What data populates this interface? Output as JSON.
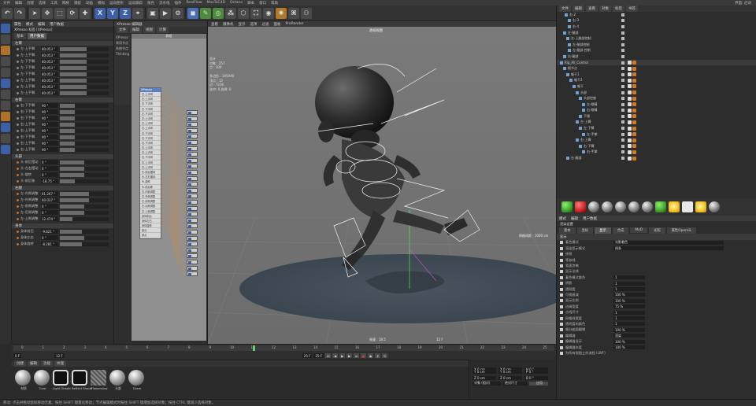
{
  "app": {
    "menu": [
      "文件",
      "编辑",
      "创建",
      "选择",
      "工具",
      "网格",
      "捕捉",
      "动画",
      "模拟",
      "运动图形",
      "运动跟踪",
      "角色",
      "流水线",
      "插件",
      "RealFlow",
      "MaxToC4D",
      "Octane",
      "脚本",
      "窗口",
      "帮助"
    ],
    "right_menu": "界面: 启动"
  },
  "toolbar": {
    "x": "X",
    "y": "Y",
    "z": "Z"
  },
  "attribute_panel": {
    "title": "属性",
    "title_tabs": [
      "模式",
      "编辑",
      "用户数据"
    ],
    "object_name": "XPresso 标签 [XPresso]",
    "tabs": [
      "基本",
      "用户数据"
    ],
    "sections": [
      {
        "name": "左臂",
        "rows": [
          {
            "label": "左-上手臂",
            "value": "80.053 °",
            "fill": 0.55
          },
          {
            "label": "左-上手臂",
            "value": "80.053 °",
            "fill": 0.55
          },
          {
            "label": "左-下手臂",
            "value": "80.053 °",
            "fill": 0.55
          },
          {
            "label": "左-下手臂",
            "value": "80.053 °",
            "fill": 0.55
          },
          {
            "label": "左-下手臂",
            "value": "80.053 °",
            "fill": 0.55
          },
          {
            "label": "左-上手臂",
            "value": "80.053 °",
            "fill": 0.55
          },
          {
            "label": "左-上手臂",
            "value": "80.053 °",
            "fill": 0.55
          },
          {
            "label": "左-上手臂",
            "value": "80.053 °",
            "fill": 0.55
          }
        ]
      },
      {
        "name": "右臂",
        "rows": [
          {
            "label": "右-下手臂",
            "value": "90 °",
            "fill": 0.3
          },
          {
            "label": "右-下手臂",
            "value": "90 °",
            "fill": 0.3
          },
          {
            "label": "右-下手臂",
            "value": "90 °",
            "fill": 0.3
          },
          {
            "label": "右-上手臂",
            "value": "90 °",
            "fill": 0.3
          },
          {
            "label": "右-上手臂",
            "value": "90 °",
            "fill": 0.3
          },
          {
            "label": "右-下手臂",
            "value": "90 °",
            "fill": 0.3
          },
          {
            "label": "右-上手臂",
            "value": "90 °",
            "fill": 0.3
          },
          {
            "label": "右-上手臂",
            "value": "90 °",
            "fill": 0.3
          }
        ]
      },
      {
        "name": "头部",
        "rows": [
          {
            "label": "头-前后摆动",
            "value": "0 °",
            "fill": 0.5
          },
          {
            "label": "头-左右摆动",
            "value": "0 °",
            "fill": 0.5
          },
          {
            "label": "头-旋转",
            "value": "0 °",
            "fill": 0.5
          },
          {
            "label": "头-前后移",
            "value": "-18.75 °",
            "fill": 0.3
          }
        ]
      },
      {
        "name": "左腿",
        "rows": [
          {
            "label": "左-内侧调整",
            "value": "61.267 °",
            "fill": 0.6
          },
          {
            "label": "左-外侧调整",
            "value": "60.037 °",
            "fill": 0.6
          },
          {
            "label": "左-前侧调整",
            "value": "0 °",
            "fill": 0.5
          },
          {
            "label": "左-后侧调整",
            "value": "0 °",
            "fill": 0.5
          },
          {
            "label": "左-上侧调整",
            "value": "12.474 °",
            "fill": 0.25
          }
        ]
      },
      {
        "name": "身体",
        "rows": [
          {
            "label": "身体前后",
            "value": "-9.821 °",
            "fill": 0.45
          },
          {
            "label": "身体左右",
            "value": "0 °",
            "fill": 0.5
          },
          {
            "label": "身体旋转",
            "value": "-8.281 °",
            "fill": 0.45
          }
        ]
      }
    ]
  },
  "xpresso": {
    "title": "XPresso 编辑器",
    "menu": [
      "文件",
      "编辑",
      "视图",
      "计算"
    ],
    "canvas_title": "群组",
    "node_list": [
      "XPresso",
      "常用节点",
      "系统节点",
      "Thinking"
    ],
    "node_header": "XPresso",
    "ports": [
      "左-上手臂",
      "左-上手臂",
      "左-下手臂",
      "左-下手臂",
      "左-下手臂",
      "左-上手臂",
      "左-上手臂",
      "左-上手臂",
      "右-下手臂",
      "右-下手臂",
      "右-下手臂",
      "右-上手臂",
      "右-上手臂",
      "右-下手臂",
      "右-上手臂",
      "右-上手臂",
      "头-前后摆动",
      "头-左右摆动",
      "头-旋转",
      "头-前后移",
      "左-内侧调整",
      "左-外侧调整",
      "左-前侧调整",
      "左-后侧调整",
      "左-上侧调整",
      "身体前后",
      "身体左右",
      "身体旋转",
      "原点",
      "原点"
    ]
  },
  "viewport": {
    "menu": [
      "查看",
      "摄像机",
      "显示",
      "选项",
      "过滤",
      "面板",
      "ProRender"
    ],
    "camera_label": "透视视图",
    "info": [
      "总计",
      "对象 : 257",
      "点 : 300",
      "",
      "多边形 : 195946",
      "顶点 : 12",
      "边 : 7236",
      "选中: 0 选择: 0"
    ],
    "grid_label": "网格间距 : 1000 cm",
    "frame_label": "帧速 : 18.5",
    "frame_num": "12 F"
  },
  "timeline": {
    "ticks": [
      "0",
      "1",
      "2",
      "3",
      "4",
      "5",
      "6",
      "7",
      "8",
      "9",
      "10",
      "11",
      "12",
      "13",
      "14",
      "15",
      "16",
      "17",
      "18",
      "19",
      "20",
      "21",
      "22",
      "23",
      "24",
      "25"
    ],
    "current_frame": "12",
    "start_field": "0 F",
    "end_field": "25 F",
    "max_field": "25 F",
    "current_field": "12 F"
  },
  "materials": {
    "menu": [
      "创建",
      "编辑",
      "功能",
      "纹理"
    ],
    "items": [
      "材质",
      "Core",
      "Light Shade",
      "Reflect Shade",
      "Flowerslow",
      "头部",
      "Gram"
    ]
  },
  "coords": {
    "rows": [
      {
        "a": "X 0 cm",
        "b": "X 0 cm",
        "c": "H 0 °"
      },
      {
        "a": "Y 0 cm",
        "b": "Y 0 cm",
        "c": "P 0 °"
      },
      {
        "a": "Z 0 cm",
        "b": "Z 0 cm",
        "c": "B 0 °"
      }
    ],
    "mode": "对象 (相对)",
    "size": "绝对尺寸",
    "apply": "应用"
  },
  "object_manager": {
    "menu": [
      "文件",
      "编辑",
      "查看",
      "对象",
      "标签",
      "书签"
    ],
    "rows": [
      "右-2",
      "右-3",
      "右-4",
      "左-腿部",
      "左-上腿部控制",
      "左-腿部控制",
      "左-腿部 控制",
      "右-腿部",
      "Rig_All_Control",
      "根节点",
      "躯干1",
      "躯干2",
      "躯干",
      "头部",
      "头部控制",
      "左-眼睛",
      "右-眼睛",
      "下颌",
      "左-上臂",
      "左-下臂",
      "左-手掌",
      "右-上臂",
      "右-下臂",
      "右-手掌",
      "右-腿部"
    ]
  },
  "render_settings": {
    "header": "渲染设置",
    "title_tabs": [
      "模式",
      "编辑",
      "用户数据"
    ],
    "tabs": [
      "基本",
      "坐标",
      "显示",
      "合成",
      "MoD",
      "光照",
      "属性OpenGL"
    ],
    "section": "显示",
    "rows": [
      {
        "label": "着色模式",
        "value": "光影着色"
      },
      {
        "label": "渲染显示模式",
        "value": "线条"
      },
      {
        "label": "线框",
        "value": ""
      },
      {
        "label": "等参线",
        "value": ""
      },
      {
        "label": "背面忽略",
        "value": ""
      },
      {
        "label": "显示法线",
        "value": ""
      },
      {
        "label": "着色模式颜色",
        "value": "1"
      },
      {
        "label": "阴影",
        "value": "1"
      },
      {
        "label": "透明度",
        "value": "1"
      },
      {
        "label": "可视衰减",
        "value": "100 %"
      },
      {
        "label": "显示比例",
        "value": "100 %"
      },
      {
        "label": "边缘宽度",
        "value": "75 %"
      },
      {
        "label": "点线尺寸",
        "value": "1"
      },
      {
        "label": "网格线宽度",
        "value": "1"
      },
      {
        "label": "透明度的颜色",
        "value": "1"
      },
      {
        "label": "细分曲面编辑",
        "value": "100 %"
      },
      {
        "label": "编辑器",
        "value": "渲染"
      },
      {
        "label": "编辑器显示",
        "value": "100 %"
      },
      {
        "label": "编辑器灰度",
        "value": "100 %"
      },
      {
        "label": "为所有视图工作流程 (LWF)",
        "value": ""
      }
    ]
  },
  "statusbar": {
    "text": "移动: 点击并拖动鼠标移动元素。按住 SHIFT 键量化移动；节点编辑模式时按住 SHIFT 键增加选择对象；按住 CTRL 键减少选择对象。"
  },
  "colors": {
    "accent": "#3d5fa6",
    "playhead": "#5fd35f",
    "tag_orange": "#d07a25"
  }
}
